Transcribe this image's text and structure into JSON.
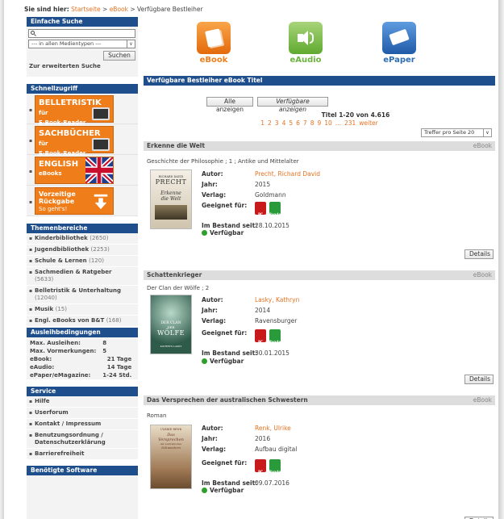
{
  "breadcrumb": {
    "prefix": "Sie sind hier:",
    "home": "Startseite",
    "sep1": ">",
    "ebook": "eBook",
    "sep2": ">",
    "current": "Verfügbare Bestleiher"
  },
  "sidebar": {
    "search": {
      "title": "Einfache Suche",
      "placeholder": "",
      "select_value": "--- in allen Medientypen ---",
      "button": "Suchen",
      "advanced": "Zur erweiterten Suche"
    },
    "quick": {
      "title": "Schnellzugriff",
      "tiles": [
        {
          "big": "BELLETRISTIK",
          "small_inline": " für",
          "line2": "E-Book-Reader",
          "icon": "ereader-icon"
        },
        {
          "big": "SACHBÜCHER",
          "small_inline": " für",
          "line2": "E-Book-Reader",
          "icon": "ereader-icon"
        },
        {
          "big": "ENGLISH",
          "small_inline": "",
          "line2": "eBooks",
          "icon": "uk-flag-icon"
        },
        {
          "big": "Vorzeitige",
          "small_inline": "",
          "line2": "Rückgabe",
          "line3": "So geht's!",
          "icon": "arrow-down-icon"
        }
      ]
    },
    "topics": {
      "title": "Themenbereiche",
      "items": [
        {
          "label": "Kinderbibliothek",
          "count": "(2650)"
        },
        {
          "label": "Jugendbibliothek",
          "count": "(2253)"
        },
        {
          "label": "Schule & Lernen",
          "count": "(120)"
        },
        {
          "label": "Sachmedien & Ratgeber",
          "count": "(5633)"
        },
        {
          "label": "Belletristik & Unterhaltung",
          "count": "(12040)"
        },
        {
          "label": "Musik",
          "count": "(15)"
        },
        {
          "label": "Engl. eBooks von B&T",
          "count": "(168)"
        }
      ]
    },
    "loan": {
      "title": "Ausleihbedingungen",
      "rows": [
        {
          "k": "Max. Ausleihen:",
          "v": "8"
        },
        {
          "k": "Max. Vormerkungen:",
          "v": "5"
        },
        {
          "k": "eBook:",
          "v": "21 Tage"
        },
        {
          "k": "eAudio:",
          "v": "14 Tage"
        },
        {
          "k": "ePaper/eMagazine:",
          "v": "1-24 Std."
        }
      ]
    },
    "service": {
      "title": "Service",
      "items": [
        "Hilfe",
        "Userforum",
        "Kontakt / Impressum",
        "Benutzungsordnung / Datenschutzerklärung",
        "Barrierefreiheit"
      ]
    },
    "software": {
      "title": "Benötigte Software"
    }
  },
  "media": [
    {
      "label": "eBook",
      "color": "#ef7e1a",
      "icon": "ebook-icon"
    },
    {
      "label": "eAudio",
      "color": "#6cb33f",
      "icon": "speaker-icon"
    },
    {
      "label": "ePaper",
      "color": "#2e6db4",
      "icon": "newspaper-icon"
    }
  ],
  "list": {
    "title": "Verfügbare Bestleiher eBook Titel",
    "btn_all": "Alle anzeigen",
    "btn_avail": "Verfügbare anzeigen",
    "count": "Titel 1-20 von 4.616",
    "pages": [
      "1",
      "2",
      "3",
      "4",
      "5",
      "6",
      "7",
      "8",
      "9",
      "10",
      "...",
      "231",
      "weiter"
    ],
    "per_page": "Treffer pro Seite 20"
  },
  "labels": {
    "autor": "Autor:",
    "jahr": "Jahr:",
    "verlag": "Verlag:",
    "geeignet": "Geeignet für:",
    "bestand": "Im Bestand seit:",
    "verfuegbar": "Verfügbar",
    "details": "Details",
    "pc": "PC",
    "reader": "Reader"
  },
  "items": [
    {
      "title": "Erkenne die Welt",
      "type": "eBook",
      "subtitle": "Geschichte der Philosophie ; 1 ; Antike und Mittelalter",
      "author": "Precht, Richard David",
      "year": "2015",
      "publisher": "Goldmann",
      "since": "28.10.2015",
      "cover": {
        "top": "RICHARD DAVID",
        "name": "PRECHT",
        "t1": "Erkenne",
        "t2": "die Welt"
      }
    },
    {
      "title": "Schattenkrieger",
      "type": "eBook",
      "subtitle": "Der Clan der Wölfe ; 2",
      "author": "Lasky, Kathryn",
      "year": "2014",
      "publisher": "Ravensburger",
      "since": "30.01.2015",
      "cover": {
        "t1": "DER CLAN",
        "t2": "DER",
        "t3": "WÖLFE",
        "name": "KATHRYN LASKY"
      }
    },
    {
      "title": "Das Versprechen der australischen Schwestern",
      "type": "eBook",
      "subtitle": "Roman",
      "author": "Renk, Ulrike",
      "year": "2016",
      "publisher": "Aufbau digital",
      "since": "09.07.2016",
      "cover": {
        "name": "ULRIKE RENK",
        "t1": "Das",
        "t2": "Versprechen",
        "t3": "der australischen",
        "t4": "Schwestern"
      }
    }
  ]
}
